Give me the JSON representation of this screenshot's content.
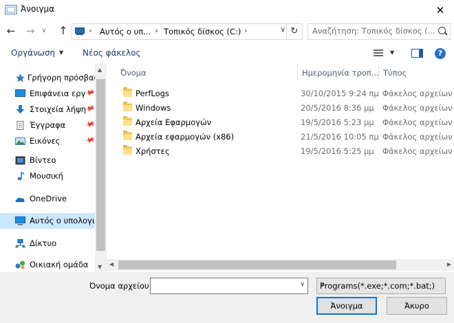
{
  "window": {
    "title": "Άνοιγμα",
    "close_glyph": "✕"
  },
  "nav": {
    "back": "←",
    "forward": "→",
    "recent": "∨",
    "up": "↑"
  },
  "address": {
    "crumbs": [
      "Αυτός ο υπ...",
      "Τοπικός δίσκος (C:)"
    ],
    "separator": "›",
    "dropdown": "∨",
    "refresh": "↻"
  },
  "search": {
    "placeholder": "Αναζήτηση: Τοπικός δίσκος (..."
  },
  "toolbar": {
    "organize": "Οργάνωση",
    "organize_caret": "▼",
    "new_folder": "Νέος φάκελος",
    "view_caret": "▼",
    "help": "?"
  },
  "sidebar": {
    "items": [
      {
        "label": "Γρήγορη πρόσβαση",
        "icon": "star-icon",
        "pinned": false
      },
      {
        "label": "Επιφάνεια εργ",
        "icon": "desktop-icon",
        "pinned": true
      },
      {
        "label": "Στοιχεία λήψη",
        "icon": "download-icon",
        "pinned": true
      },
      {
        "label": "Έγγραφα",
        "icon": "documents-icon",
        "pinned": true
      },
      {
        "label": "Εικόνες",
        "icon": "pictures-icon",
        "pinned": true
      },
      {
        "label": "Βίντεο",
        "icon": "video-icon",
        "pinned": false
      },
      {
        "label": "Μουσική",
        "icon": "music-icon",
        "pinned": false
      },
      {
        "label": "OneDrive",
        "icon": "onedrive-icon",
        "pinned": false
      },
      {
        "label": "Αυτός ο υπολογι",
        "icon": "this-pc-icon",
        "pinned": false,
        "selected": true
      },
      {
        "label": "Δίκτυο",
        "icon": "network-icon",
        "pinned": false
      },
      {
        "label": "Οικιακή ομάδα",
        "icon": "homegroup-icon",
        "pinned": false
      }
    ],
    "pin_glyph": "📌"
  },
  "columns": {
    "name": "Όνομα",
    "date": "Ημερομηνία τροπ...",
    "type": "Τύπος",
    "sort_glyph": "^"
  },
  "files": [
    {
      "name": "PerfLogs",
      "date": "30/10/2015 9:24 πμ",
      "type": "Φάκελος αρχείων"
    },
    {
      "name": "Windows",
      "date": "20/5/2016 8:36 μμ",
      "type": "Φάκελος αρχείων"
    },
    {
      "name": "Αρχεία Εφαρμογών",
      "date": "19/5/2016 5:23 μμ",
      "type": "Φάκελος αρχείων"
    },
    {
      "name": "Αρχεία εφαρμογών (x86)",
      "date": "21/5/2016 10:05 πμ",
      "type": "Φάκελος αρχείων"
    },
    {
      "name": "Χρήστες",
      "date": "19/5/2016 5:25 μμ",
      "type": "Φάκελος αρχείων"
    }
  ],
  "scroll": {
    "up": "▲",
    "down": "▼",
    "left": "◀",
    "right": "▶"
  },
  "footer": {
    "filename_label": "Όνομα αρχείου:",
    "filename_value": "",
    "dropdown": "∨",
    "filter": "Programs(*.exe;*.com;*.bat;)",
    "open": "Άνοιγμα",
    "cancel": "Άκυρο"
  },
  "colors": {
    "selected_bg": "#cce8ff",
    "accent": "#0078d7",
    "folder": "#ffe08a"
  }
}
